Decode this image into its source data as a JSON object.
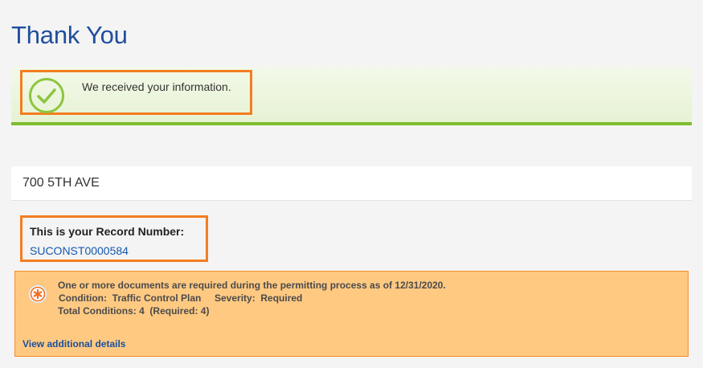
{
  "page": {
    "title": "Thank You"
  },
  "success_banner": {
    "message": "We received your information.",
    "icon": "check-circle-icon",
    "accent_color": "#7cbe2c"
  },
  "address": {
    "text": "700 5TH AVE"
  },
  "record": {
    "label": "This is your Record Number:",
    "number": "SUCONST0000584"
  },
  "notice": {
    "icon": "asterisk-alert-icon",
    "line1": "One or more documents are required during the permitting process as of 12/31/2020.",
    "line2": "Condition:  Traffic Control Plan     Severity:  Required",
    "line3": "Total Conditions: 4  (Required: 4)",
    "link_text": "View additional details",
    "background_color": "#ffc982"
  },
  "highlight_color": "#f47d20"
}
